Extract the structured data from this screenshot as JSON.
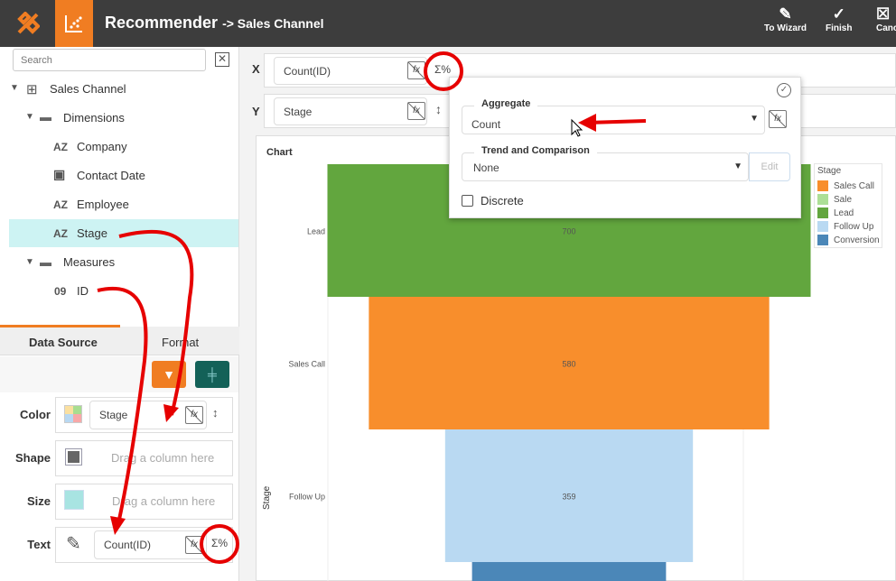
{
  "header": {
    "title": "Recommender",
    "subtitle": "-> Sales Channel",
    "buttons": [
      {
        "label": "To Wizard",
        "icon": "pencil-icon"
      },
      {
        "label": "Finish",
        "icon": "check-circle-icon"
      },
      {
        "label": "Cancel",
        "icon": "close-box-icon"
      }
    ]
  },
  "left": {
    "search_placeholder": "Search",
    "tree": {
      "root": "Sales Channel",
      "dimensions": "Dimensions",
      "dim_items": [
        {
          "type": "AZ",
          "label": "Company"
        },
        {
          "type": "date",
          "label": "Contact Date"
        },
        {
          "type": "AZ",
          "label": "Employee"
        },
        {
          "type": "AZ",
          "label": "Stage"
        }
      ],
      "measures": "Measures",
      "meas_items": [
        {
          "type": "09",
          "label": "ID"
        }
      ]
    },
    "tabs": [
      "Data Source",
      "Format"
    ],
    "bindings": {
      "color": {
        "label": "Color",
        "value": "Stage"
      },
      "shape": {
        "label": "Shape",
        "placeholder": "Drag a column here"
      },
      "size": {
        "label": "Size",
        "placeholder": "Drag a column here"
      },
      "text": {
        "label": "Text",
        "value": "Count(ID)"
      }
    }
  },
  "axes": {
    "x_label": "X",
    "x_value": "Count(ID)",
    "y_label": "Y",
    "y_value": "Stage"
  },
  "popup": {
    "aggregate_label": "Aggregate",
    "aggregate_value": "Count",
    "trend_label": "Trend and Comparison",
    "trend_value": "None",
    "edit_label": "Edit",
    "discrete_label": "Discrete",
    "discrete_checked": false
  },
  "chart": {
    "title": "Chart"
  },
  "chart_data": {
    "type": "bar",
    "orientation": "funnel",
    "ylabel": "Stage",
    "categories": [
      "Lead",
      "Sales Call",
      "Follow Up",
      "Conversion"
    ],
    "values": [
      700,
      580,
      359,
      281
    ],
    "labels": [
      "700",
      "580",
      "359",
      ""
    ],
    "colors": [
      "#62a63e",
      "#f88e2c",
      "#b9d9f2",
      "#4b87b8"
    ],
    "legend": {
      "title": "Stage",
      "placement": "right",
      "items": [
        {
          "name": "Sales Call",
          "color": "#f88e2c"
        },
        {
          "name": "Sale",
          "color": "#acdf96"
        },
        {
          "name": "Lead",
          "color": "#62a63e"
        },
        {
          "name": "Follow Up",
          "color": "#b9d9f2"
        },
        {
          "name": "Conversion",
          "color": "#4b87b8"
        }
      ]
    }
  }
}
